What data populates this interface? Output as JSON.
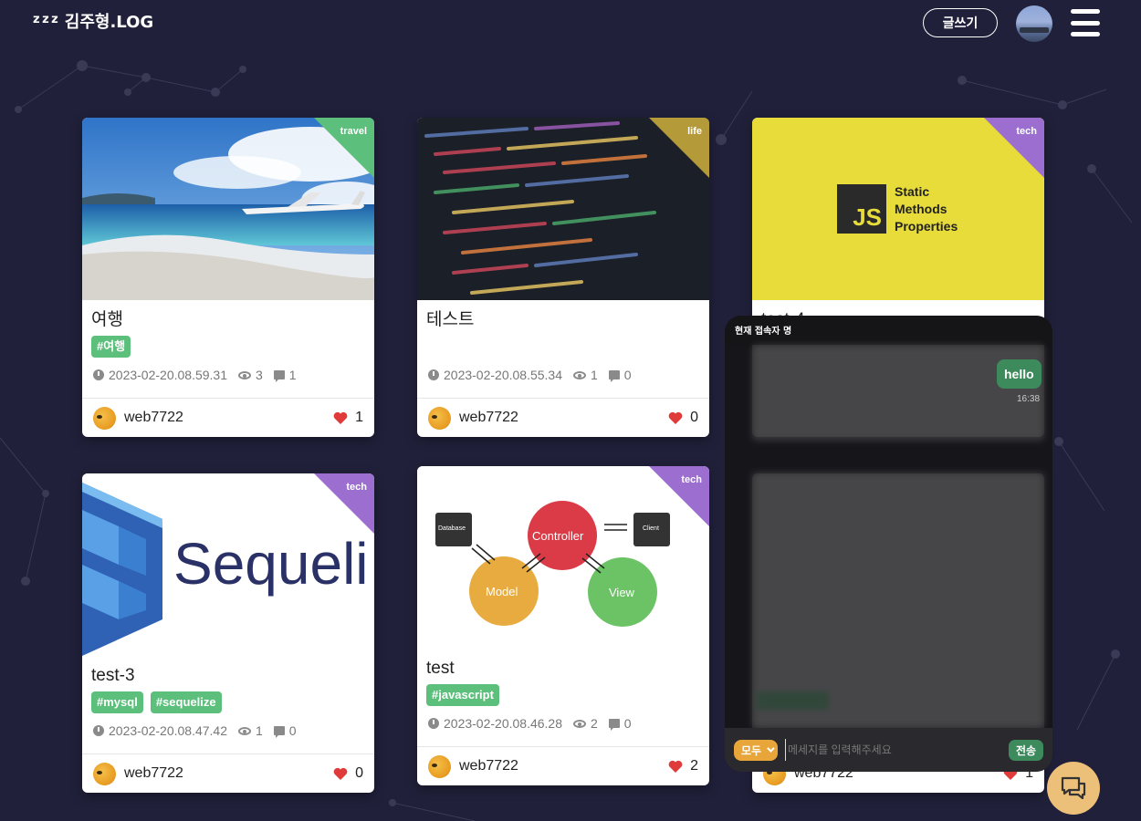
{
  "header": {
    "logo_mark": "z z z",
    "logo_text": "김주형.LOG",
    "write_label": "글쓰기"
  },
  "posts": [
    {
      "title": "여행",
      "category": "travel",
      "category_color": "#5cbf7b",
      "tags": [
        "#여행"
      ],
      "date": "2023-02-20.08.59.31",
      "views": "3",
      "comments": "1",
      "author": "web7722",
      "likes": "1"
    },
    {
      "title": "테스트",
      "category": "life",
      "category_color": "#b59a3a",
      "tags": [],
      "date": "2023-02-20.08.55.34",
      "views": "1",
      "comments": "0",
      "author": "web7722",
      "likes": "0"
    },
    {
      "title": "test-4",
      "category": "tech",
      "category_color": "#9b6ed0",
      "tags": [],
      "thumb_text": [
        "Static",
        "Methods",
        "Properties"
      ],
      "thumb_badge": "JS",
      "author": "web7722",
      "likes": "1"
    },
    {
      "title": "test-3",
      "category": "tech",
      "category_color": "#9b6ed0",
      "tags": [
        "#mysql",
        "#sequelize"
      ],
      "date": "2023-02-20.08.47.42",
      "views": "1",
      "comments": "0",
      "author": "web7722",
      "likes": "0",
      "thumb_text": "Sequeli"
    },
    {
      "title": "test",
      "category": "tech",
      "category_color": "#9b6ed0",
      "tags": [
        "#javascript"
      ],
      "date": "2023-02-20.08.46.28",
      "views": "2",
      "comments": "0",
      "author": "web7722",
      "likes": "2",
      "diagram": {
        "database": "Database",
        "controller": "Controller",
        "client": "Client",
        "model": "Model",
        "view": "View"
      }
    }
  ],
  "chat": {
    "header": "현재 접속자 명",
    "message": "hello",
    "time": "16:38",
    "target": "모두",
    "placeholder": "메세지를 입력해주세요",
    "send_label": "전송"
  },
  "colors": {
    "background": "#20203a",
    "tag": "#5cbf7b",
    "chat_accent": "#e8a53a",
    "heart": "#e03b3b"
  },
  "icons": {
    "menu": "hamburger-icon",
    "views": "eye-icon",
    "comments": "comment-icon",
    "date": "clock-icon",
    "likes": "heart-icon",
    "chat": "chat-icon"
  }
}
